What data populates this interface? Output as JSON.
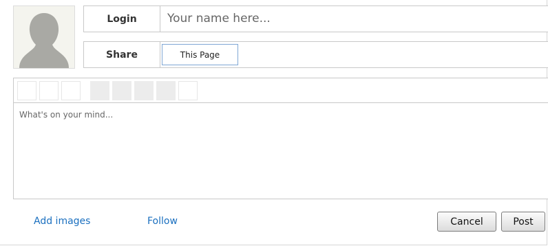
{
  "profile": {
    "avatar_icon": "default-user-silhouette-icon"
  },
  "login": {
    "label": "Login",
    "placeholder": "Your name here..."
  },
  "share": {
    "label": "Share",
    "selected": "This Page"
  },
  "editor": {
    "toolbar": [
      {
        "icon": "toolbar-button-1-icon",
        "enabled": true
      },
      {
        "icon": "toolbar-button-2-icon",
        "enabled": true
      },
      {
        "icon": "toolbar-button-3-icon",
        "enabled": true
      },
      {
        "icon": "toolbar-button-4-icon",
        "enabled": false
      },
      {
        "icon": "toolbar-button-5-icon",
        "enabled": false
      },
      {
        "icon": "toolbar-button-6-icon",
        "enabled": false
      },
      {
        "icon": "toolbar-button-7-icon",
        "enabled": false
      },
      {
        "icon": "toolbar-button-8-icon",
        "enabled": true
      }
    ],
    "placeholder": "What's on your mind..."
  },
  "actions": {
    "add_images": "Add images",
    "follow": "Follow",
    "cancel": "Cancel",
    "post": "Post"
  },
  "colors": {
    "link": "#1a6fbf",
    "border": "#c8c8c8",
    "select_border": "#7ea6d4",
    "disabled_tool": "#ececec"
  }
}
